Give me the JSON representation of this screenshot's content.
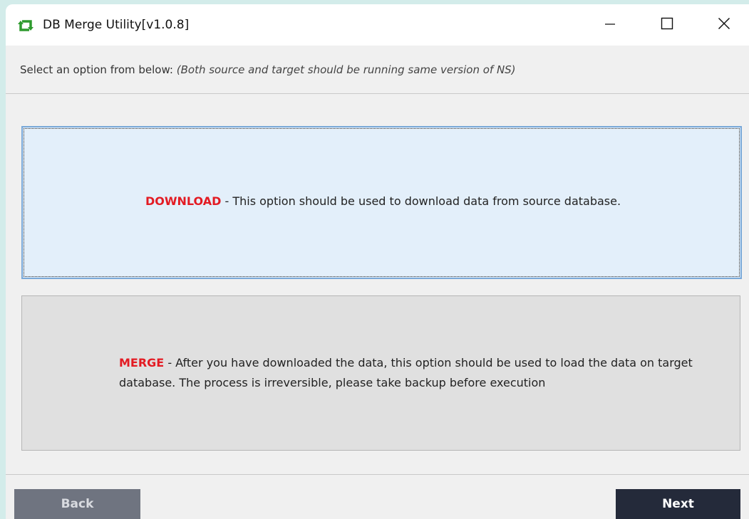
{
  "window": {
    "title": "DB Merge Utility[v1.0.8]",
    "icon": "refresh-arrows-icon",
    "controls": {
      "minimize": "minimize-icon",
      "maximize": "maximize-icon",
      "close": "close-icon"
    }
  },
  "instruction": {
    "prefix": "Select an option from below: ",
    "note": "(Both source and target should be running same version of NS)"
  },
  "options": [
    {
      "keyword": "DOWNLOAD",
      "description": " - This option should be used to download data from source database.",
      "selected": true
    },
    {
      "keyword": "MERGE",
      "description": " - After you have downloaded the data, this option should be used to load the data on target database. The process is irreversible, please take backup before execution",
      "selected": false
    }
  ],
  "buttons": {
    "back_label": "Back",
    "next_label": "Next"
  },
  "colors": {
    "keyword": "#e31b23",
    "selected_option_bg": "#e3effa",
    "option_bg": "#e0e0e0",
    "next_button_bg": "#242a3a",
    "back_button_bg": "#6f7480",
    "app_icon": "#2e9a2e"
  }
}
